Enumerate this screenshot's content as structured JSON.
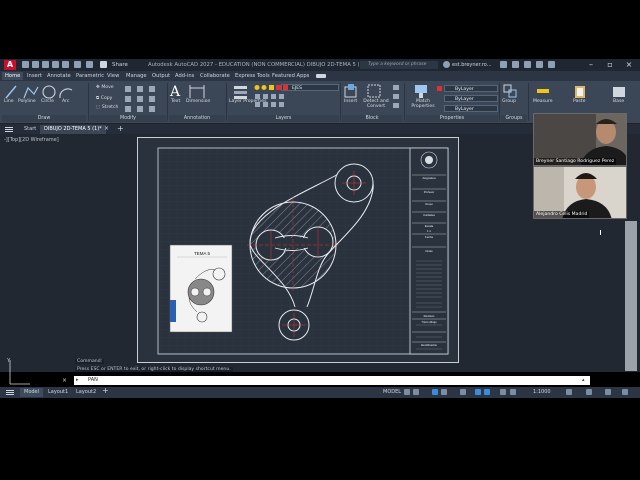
{
  "titlebar": {
    "app_logo": "A",
    "share": "Share",
    "title": "Autodesk AutoCAD 2027 - EDUCATION (NON COMMERCIAL)    DIBUJO 2D-TEMA 5 (1).dwg",
    "search_placeholder": "Type a keyword or phrase",
    "user": "est.breyner.ro..."
  },
  "ribbon_tabs": [
    "Home",
    "Insert",
    "Annotate",
    "Parametric",
    "View",
    "Manage",
    "Output",
    "Add-ins",
    "Collaborate",
    "Express Tools",
    "Featured Apps"
  ],
  "ribbon": {
    "draw_tools": [
      "Line",
      "Polyline",
      "Circle",
      "Arc"
    ],
    "modify_tools": [
      "Move",
      "Copy",
      "Stretch"
    ],
    "annotation_tools": [
      "Text",
      "Dimension"
    ],
    "layer_properties": "Layer Properties",
    "layer_current": "EJES",
    "insert": "Insert",
    "detect_convert": "Detect and Convert",
    "match_properties": "Match Properties",
    "bylayer": [
      "ByLayer",
      "ByLayer",
      "ByLayer"
    ],
    "group": "Group",
    "measure": "Measure",
    "paste": "Paste",
    "base": "Base",
    "panels": [
      "Draw",
      "Modify",
      "Annotation",
      "Layers",
      "Block",
      "Properties",
      "Groups"
    ]
  },
  "doc_tabs": [
    "Start",
    "DIBUJO 2D-TEMA 5 (1)*"
  ],
  "viewport_label": "-][Top][2D Wireframe]",
  "title_block": {
    "sections": [
      "Asignatura",
      "Profesor",
      "Grupo",
      "Unidades",
      "Escala",
      "Fecha",
      "Notas",
      "Revisión",
      "Título dibujo",
      "Identificación"
    ],
    "scale": "1:1",
    "reference_title": "TEMA 5"
  },
  "command": {
    "history_1": "Command:",
    "history_2": "Press ESC or ENTER to exit, or right-click to display shortcut menu.",
    "input": "PAN"
  },
  "status_tabs": [
    "Model",
    "Layout1",
    "Layout2"
  ],
  "status": {
    "model": "MODEL",
    "scale": "1:1000"
  },
  "participants": [
    {
      "name": "Breyner Santiago Rodriguez Perez"
    },
    {
      "name": "Alejandro Celis Madrid"
    }
  ]
}
